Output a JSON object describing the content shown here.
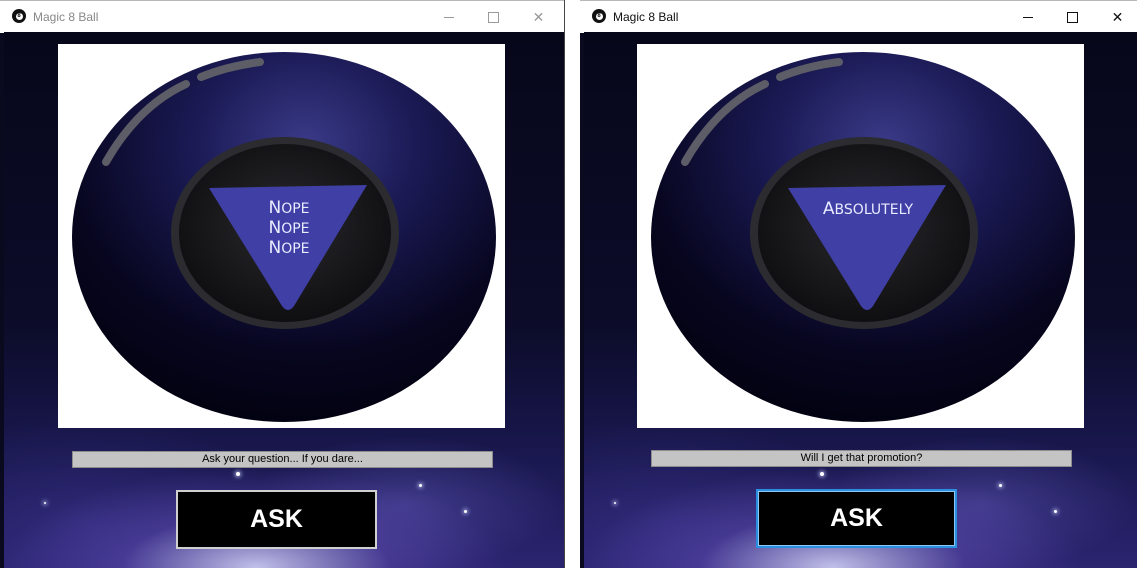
{
  "windows": [
    {
      "title": "Magic 8 Ball",
      "answer_lines": [
        "Nope",
        "Nope",
        "Nope"
      ],
      "question_text": "Ask your question... If you dare...",
      "ask_label": "ASK",
      "controls": {
        "minimize": "minimize-icon",
        "maximize": "maximize-icon",
        "close": "close-icon"
      }
    },
    {
      "title": "Magic 8 Ball",
      "answer_lines": [
        "Absolutely"
      ],
      "question_text": "Will I get that promotion?",
      "ask_label": "ASK",
      "controls": {
        "minimize": "minimize-icon",
        "maximize": "maximize-icon",
        "close": "close-icon"
      }
    }
  ],
  "colors": {
    "ball": "#0b0a2e",
    "triangle": "#3f3fa6",
    "window_inactive_title": "#888888",
    "window_active_title": "#111111",
    "focus_border": "#2a8fe0"
  }
}
